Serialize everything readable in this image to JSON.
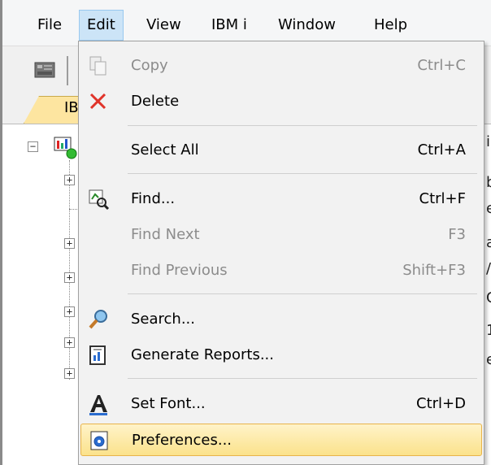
{
  "menubar": {
    "items": [
      "File",
      "Edit",
      "View",
      "IBM i",
      "Window",
      "Help"
    ],
    "active": "Edit"
  },
  "tab": {
    "label": "IB"
  },
  "background_right_text": [
    "i",
    "b",
    "e",
    "a",
    "/",
    "C",
    "1",
    "e"
  ],
  "edit_menu": {
    "items": [
      {
        "label": "Copy",
        "shortcut": "Ctrl+C",
        "icon": "copy-icon",
        "enabled": false
      },
      {
        "label": "Delete",
        "shortcut": "",
        "icon": "delete-x-icon",
        "enabled": true
      },
      {
        "label": "Select All",
        "shortcut": "Ctrl+A",
        "icon": "",
        "enabled": true
      },
      {
        "label": "Find...",
        "shortcut": "Ctrl+F",
        "icon": "find-icon",
        "enabled": true
      },
      {
        "label": "Find Next",
        "shortcut": "F3",
        "icon": "",
        "enabled": false
      },
      {
        "label": "Find Previous",
        "shortcut": "Shift+F3",
        "icon": "",
        "enabled": false
      },
      {
        "label": "Search...",
        "shortcut": "",
        "icon": "search-magnifier-icon",
        "enabled": true
      },
      {
        "label": "Generate Reports...",
        "shortcut": "",
        "icon": "report-icon",
        "enabled": true
      },
      {
        "label": "Set Font...",
        "shortcut": "Ctrl+D",
        "icon": "font-icon",
        "enabled": true
      },
      {
        "label": "Preferences...",
        "shortcut": "",
        "icon": "preferences-icon",
        "enabled": true,
        "highlighted": true
      }
    ]
  },
  "colors": {
    "menu_highlight": "#fbe28b",
    "menubar_active": "#cce4f7",
    "delete_red": "#e0342a",
    "tab_yellow": "#fde5a0"
  }
}
